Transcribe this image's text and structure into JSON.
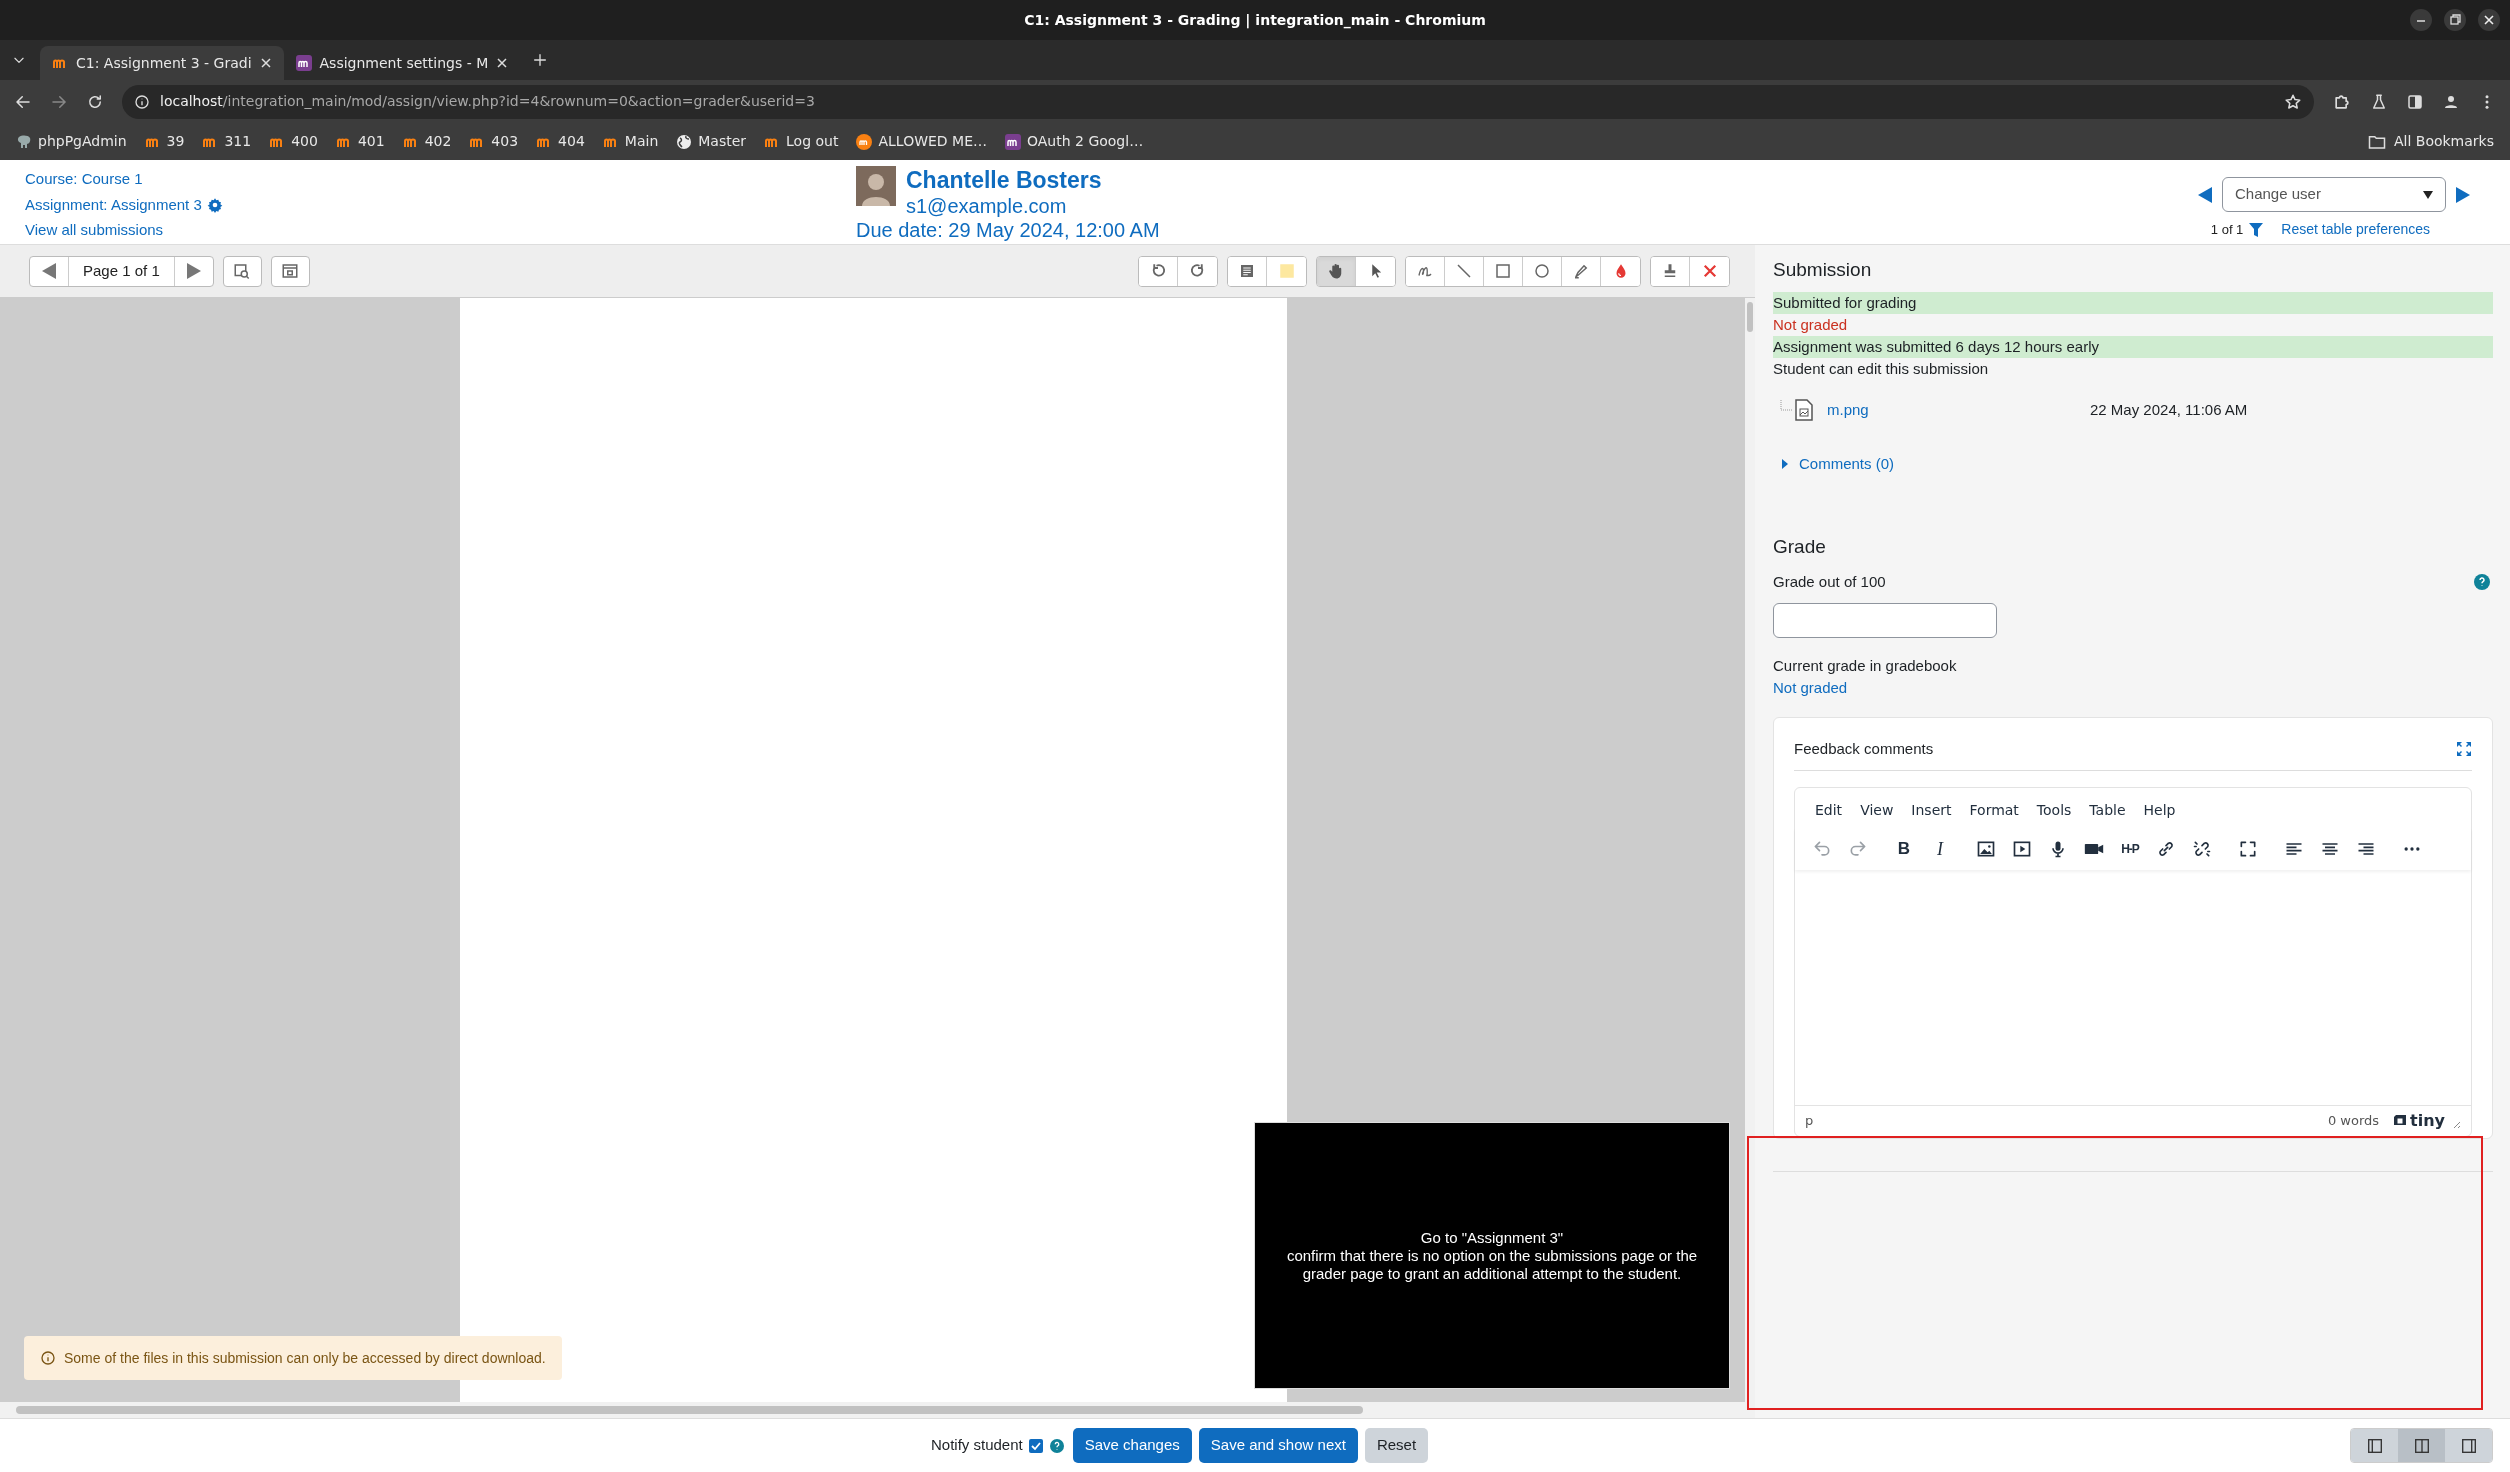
{
  "window": {
    "title": "C1: Assignment 3 - Grading | integration_main - Chromium"
  },
  "tabs": [
    {
      "title": "C1: Assignment 3 - Gradi",
      "selected": true,
      "kind": "orange"
    },
    {
      "title": "Assignment settings - M",
      "selected": false,
      "kind": "purple"
    }
  ],
  "address": {
    "host": "localhost",
    "path": "/integration_main/mod/assign/view.php?id=4&rownum=0&action=grader&userid=3"
  },
  "bookmarks": [
    {
      "label": "phpPgAdmin",
      "kind": "elephant"
    },
    {
      "label": "39",
      "kind": "arch"
    },
    {
      "label": "311",
      "kind": "arch"
    },
    {
      "label": "400",
      "kind": "arch"
    },
    {
      "label": "401",
      "kind": "arch"
    },
    {
      "label": "402",
      "kind": "arch"
    },
    {
      "label": "403",
      "kind": "arch"
    },
    {
      "label": "404",
      "kind": "arch"
    },
    {
      "label": "Main",
      "kind": "arch"
    },
    {
      "label": "Master",
      "kind": "globe"
    },
    {
      "label": "Log out",
      "kind": "arch"
    },
    {
      "label": "ALLOWED ME…",
      "kind": "badge"
    },
    {
      "label": "OAuth 2 Googl…",
      "kind": "purple"
    }
  ],
  "all_bookmarks": "All Bookmarks",
  "header": {
    "course": "Course: Course 1",
    "assignment": "Assignment: Assignment 3",
    "view_all": "View all submissions",
    "user_name": "Chantelle Bosters",
    "user_email": "s1@example.com",
    "due_date": "Due date: 29 May 2024, 12:00 AM",
    "change_user": "Change user",
    "pager": "1 of 1",
    "reset": "Reset table preferences"
  },
  "viewer": {
    "page_label": "Page 1 of 1",
    "tool_groups": [
      {
        "tools": [
          {
            "kind": "rotate-left",
            "selected": false
          },
          {
            "kind": "rotate-right",
            "selected": false
          }
        ]
      },
      {
        "tools": [
          {
            "kind": "comment",
            "selected": false
          },
          {
            "kind": "swatch",
            "selected": false
          }
        ]
      },
      {
        "tools": [
          {
            "kind": "hand",
            "selected": true
          },
          {
            "kind": "pointer",
            "selected": false
          }
        ]
      },
      {
        "tools": [
          {
            "kind": "pen",
            "selected": false
          },
          {
            "kind": "line",
            "selected": false
          },
          {
            "kind": "rectangle",
            "selected": false
          },
          {
            "kind": "oval",
            "selected": false
          },
          {
            "kind": "highlighter",
            "selected": false
          },
          {
            "kind": "color",
            "selected": false
          }
        ]
      },
      {
        "tools": [
          {
            "kind": "stamp",
            "selected": false
          },
          {
            "kind": "delete",
            "selected": false
          }
        ]
      }
    ],
    "notice": "Some of the files in this submission can only be accessed by direct download.",
    "caption": [
      "Go to \"Assignment 3\"",
      "confirm that there is no option on the submissions page or the",
      "grader page to grant an additional attempt to the student."
    ]
  },
  "submission": {
    "heading": "Submission",
    "statuses": [
      {
        "text": "Submitted for grading",
        "kind": "success"
      },
      {
        "text": "Not graded",
        "kind": "danger"
      },
      {
        "text": "Assignment was submitted 6 days 12 hours early",
        "kind": "success"
      },
      {
        "text": "Student can edit this submission",
        "kind": "plain"
      }
    ],
    "file": {
      "name": "m.png",
      "date": "22 May 2024, 11:06 AM"
    },
    "comments": {
      "label": "Comments (0)",
      "expanded": false
    }
  },
  "grade": {
    "heading": "Grade",
    "label": "Grade out of 100",
    "current_label": "Current grade in gradebook",
    "current_value": "Not graded"
  },
  "feedback": {
    "title": "Feedback comments",
    "menu": [
      "Edit",
      "View",
      "Insert",
      "Format",
      "Tools",
      "Table",
      "Help"
    ],
    "tools": [
      {
        "kind": "undo",
        "disabled": true
      },
      {
        "kind": "redo",
        "disabled": true
      },
      {
        "kind": "bold",
        "label": "B",
        "disabled": false
      },
      {
        "kind": "italic",
        "label": "I",
        "disabled": false
      },
      {
        "kind": "image",
        "disabled": false
      },
      {
        "kind": "media",
        "disabled": false
      },
      {
        "kind": "mic",
        "disabled": false
      },
      {
        "kind": "camera",
        "disabled": false
      },
      {
        "kind": "h5p",
        "label": "H-P",
        "disabled": false
      },
      {
        "kind": "link",
        "disabled": false
      },
      {
        "kind": "unlink",
        "disabled": false
      },
      {
        "kind": "fullscreen",
        "disabled": false
      },
      {
        "kind": "align-left",
        "disabled": false
      },
      {
        "kind": "align-center",
        "disabled": false
      },
      {
        "kind": "align-right",
        "disabled": false
      },
      {
        "kind": "more",
        "disabled": false
      }
    ],
    "path": "p",
    "word_count": "0 words",
    "brand": "tiny"
  },
  "footer": {
    "notify_label": "Notify student",
    "notify_checked": true,
    "buttons": [
      {
        "label": "Save changes",
        "kind": "primary"
      },
      {
        "label": "Save and show next",
        "kind": "primary"
      },
      {
        "label": "Reset",
        "kind": "secondary"
      }
    ],
    "layouts": [
      {
        "kind": "left",
        "selected": false
      },
      {
        "kind": "split",
        "selected": true
      },
      {
        "kind": "right",
        "selected": false
      }
    ]
  }
}
